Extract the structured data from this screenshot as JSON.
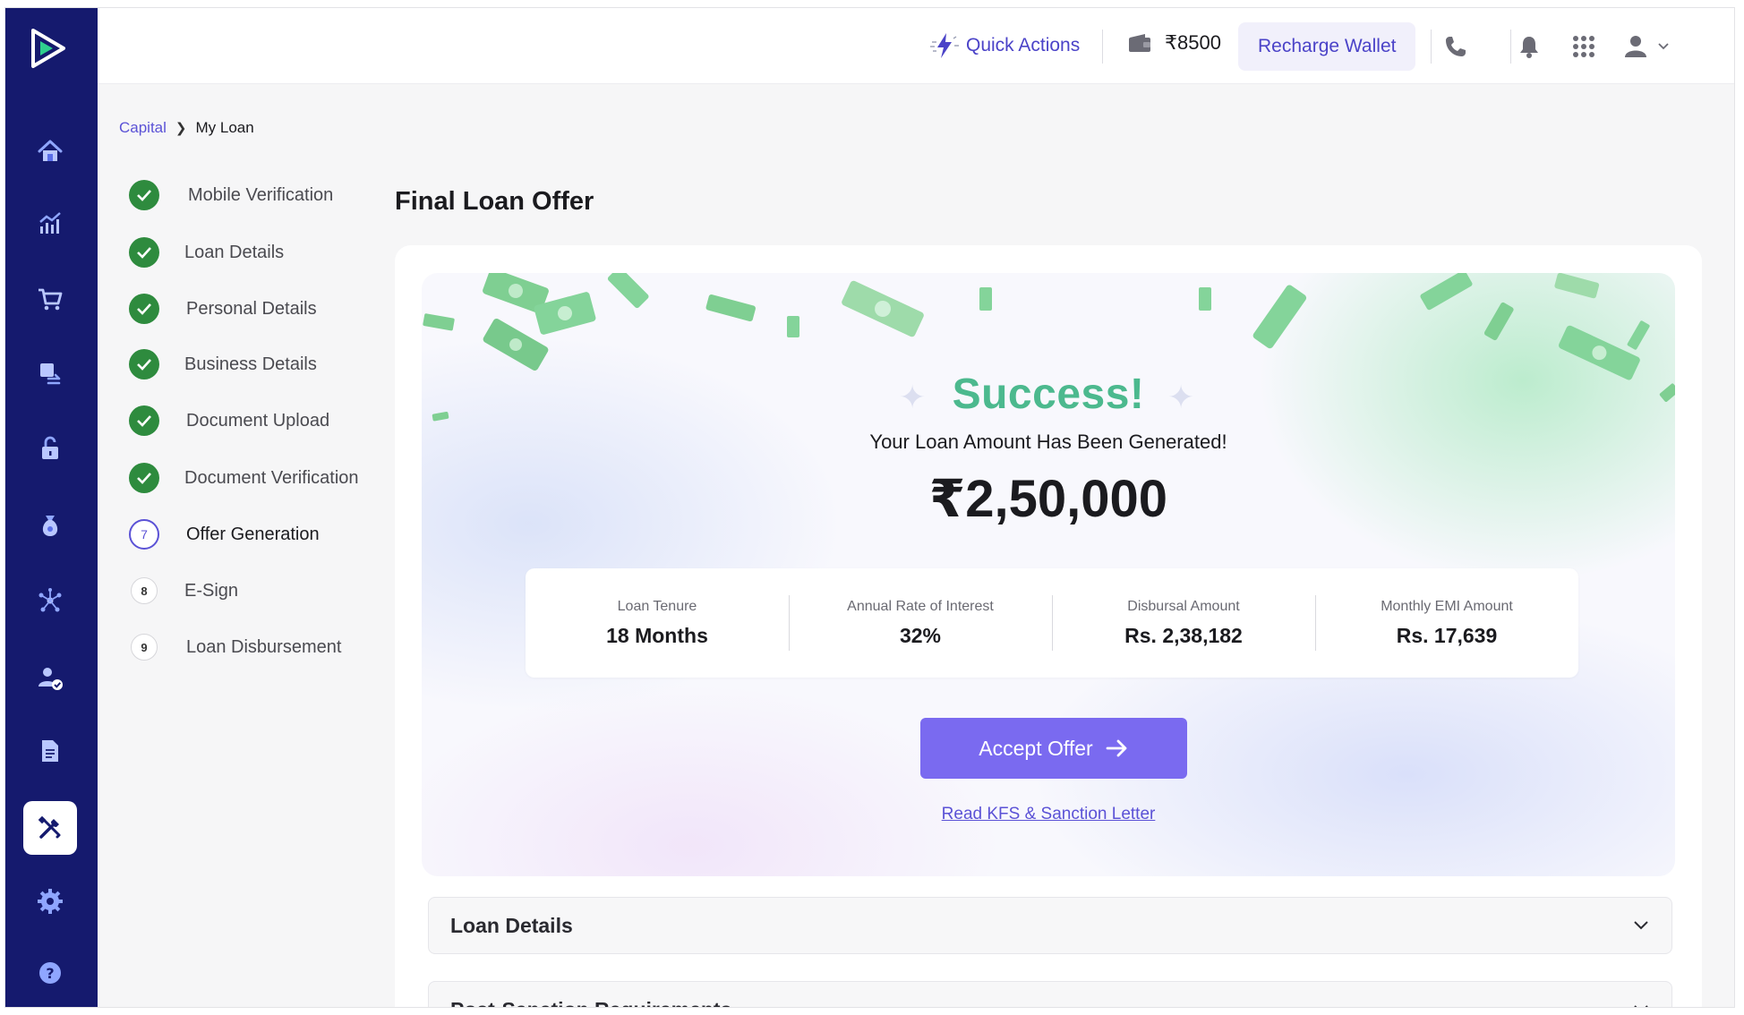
{
  "colors": {
    "sidebar_bg": "#151a6e",
    "accent": "#5b52d6",
    "button": "#7a6af0",
    "success_green": "#2e8b3e",
    "success_text": "#4cb98e"
  },
  "sidebar": {
    "items": [
      {
        "icon": "home-icon"
      },
      {
        "icon": "analytics-icon"
      },
      {
        "icon": "cart-icon"
      },
      {
        "icon": "returns-icon"
      },
      {
        "icon": "unlock-icon"
      },
      {
        "icon": "money-bag-icon"
      },
      {
        "icon": "network-icon"
      },
      {
        "icon": "user-verified-icon"
      },
      {
        "icon": "document-icon"
      },
      {
        "icon": "tools-icon",
        "active": true
      },
      {
        "icon": "settings-icon"
      },
      {
        "icon": "help-icon"
      }
    ]
  },
  "header": {
    "quick_actions": "Quick Actions",
    "wallet_balance": "₹8500",
    "recharge_label": "Recharge Wallet"
  },
  "breadcrumb": {
    "parent": "Capital",
    "current": "My Loan"
  },
  "steps": [
    {
      "label": "Mobile Verification",
      "status": "done"
    },
    {
      "label": "Loan Details",
      "status": "done"
    },
    {
      "label": "Personal Details",
      "status": "done"
    },
    {
      "label": "Business Details",
      "status": "done"
    },
    {
      "label": "Document Upload",
      "status": "done"
    },
    {
      "label": "Document Verification",
      "status": "done"
    },
    {
      "label": "Offer Generation",
      "status": "current",
      "number": "7"
    },
    {
      "label": "E-Sign",
      "status": "todo",
      "number": "8"
    },
    {
      "label": "Loan Disbursement",
      "status": "todo",
      "number": "9"
    }
  ],
  "main": {
    "title": "Final Loan Offer",
    "success": "Success!",
    "generated": "Your Loan Amount Has Been Generated!",
    "amount": "₹2,50,000",
    "stats": [
      {
        "label": "Loan Tenure",
        "value": "18 Months"
      },
      {
        "label": "Annual Rate of Interest",
        "value": "32%"
      },
      {
        "label": "Disbursal Amount",
        "value": "Rs. 2,38,182"
      },
      {
        "label": "Monthly EMI Amount",
        "value": "Rs. 17,639"
      }
    ],
    "accept_label": "Accept Offer",
    "kfs_link": "Read KFS & Sanction Letter",
    "sections": [
      "Loan Details",
      "Post-Sanction Requirements"
    ]
  }
}
